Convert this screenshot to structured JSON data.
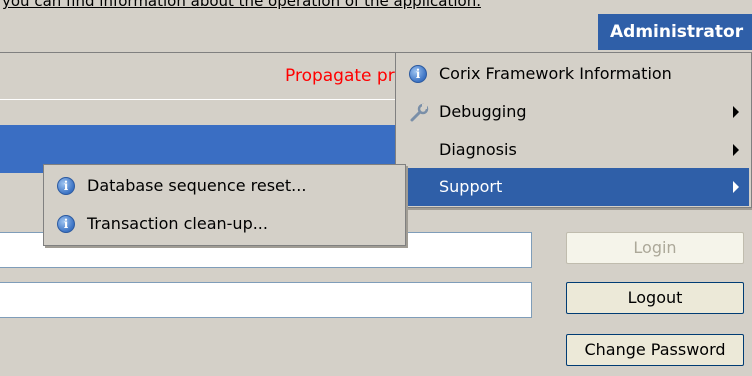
{
  "header": {
    "top_text": "you can find information about the operation of the application."
  },
  "menubar": {
    "admin_label": "Administrator"
  },
  "status": {
    "message": "Propagate pr"
  },
  "admin_menu": {
    "items": [
      {
        "label": "Corix Framework Information",
        "icon": "info-icon",
        "submenu": false
      },
      {
        "label": "Debugging",
        "icon": "wrench-icon",
        "submenu": true
      },
      {
        "label": "Diagnosis",
        "icon": "",
        "submenu": true
      },
      {
        "label": "Support",
        "icon": "",
        "submenu": true,
        "selected": true
      }
    ]
  },
  "support_menu": {
    "items": [
      {
        "label": "Database sequence reset...",
        "icon": "info-icon"
      },
      {
        "label": "Transaction clean-up...",
        "icon": "info-icon"
      }
    ]
  },
  "login": {
    "login_label": "Login",
    "logout_label": "Logout",
    "change_password_label": "Change Password",
    "login_enabled": false
  },
  "colors": {
    "selection": "#2f5fa8",
    "status_text": "#ff0000",
    "panel": "#d4d0c8"
  }
}
